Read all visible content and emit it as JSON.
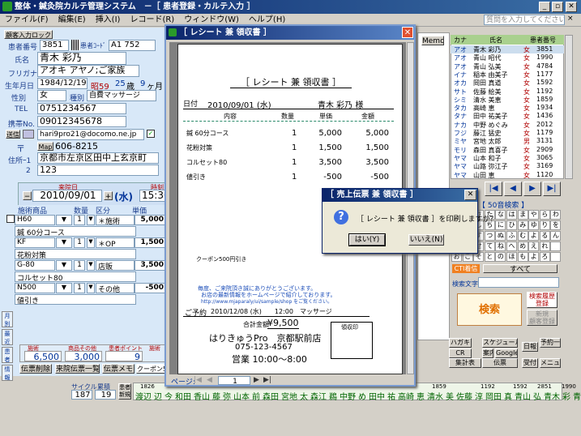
{
  "app": {
    "title": "整体・鍼灸院カルテ管理システム　－［ 患者登録・カルテ入力 ］",
    "search_placeholder": "質問を入力してください"
  },
  "menu": [
    "ファイル(F)",
    "編集(E)",
    "挿入(I)",
    "レコード(R)",
    "ウィンドウ(W)",
    "ヘルプ(H)"
  ],
  "patient": {
    "header_btn": "顧客入力ロック",
    "id_label": "患者番号",
    "id": "3851",
    "code_label": "患者ｺｰﾄﾞ",
    "code": "A1 752",
    "name_label": "氏名",
    "name": "青木 彩乃",
    "furigana_label": "フリガナ",
    "furigana": "アオキ アヤノ;ご家族",
    "dob_label": "生年月日",
    "dob": "1984/12/19",
    "era": "昭59",
    "age": "25",
    "age_unit": "歳",
    "months": "9",
    "months_unit": "ヶ月",
    "sex_label": "性別",
    "sex": "女",
    "category_label": "種別",
    "category": "自費マッサージ",
    "tel_label": "TEL",
    "tel": "0751234567",
    "mobile_label": "携帯No.",
    "mobile": "09012345678",
    "email_btn": "送信",
    "email": "hari9pro21@docomo.ne.jp",
    "map_btn": "Map",
    "zip": "606-8215",
    "addr_label": "住所ｰ1",
    "addr1": "京都市左京区田中上玄京町",
    "addr2_label": "2",
    "addr2": "123",
    "visit_label": "来院日",
    "visit_date": "2010/09/01",
    "weekday": "(水)",
    "time_label": "時刻",
    "time": "15:30"
  },
  "order": {
    "headers": [
      "施術商品",
      "数量",
      "区分",
      "単価"
    ],
    "rows": [
      {
        "code": "H60",
        "qty": "1",
        "kind": "＊施術",
        "price": "5,000",
        "desc": "鍼 60分コース"
      },
      {
        "code": "KF",
        "qty": "1",
        "kind": "＊OP",
        "price": "1,500",
        "desc": "花粉対策"
      },
      {
        "code": "G-80",
        "qty": "1",
        "kind": "店販",
        "price": "3,500",
        "desc": "コルセット80"
      },
      {
        "code": "N500",
        "qty": "1",
        "kind": "その他",
        "price": "-500",
        "desc": "値引き"
      }
    ],
    "totals_labels": [
      "施術",
      "商品その他",
      "患者ポイント",
      "施術"
    ],
    "totals": [
      "6,500",
      "3,000",
      "9"
    ],
    "btn_delete": "伝票削除",
    "btn_list": "来院伝票一覧",
    "btn_memo": "伝票メモ",
    "btn_coupon": "クーポン500",
    "side_tabs": [
      "月別",
      "最近",
      "患者",
      "情報"
    ],
    "cycle_label": "サイクル",
    "cycle_vals": [
      "187",
      "19"
    ],
    "cycle_sub": "累積",
    "renew": "患者新規"
  },
  "receipt_window": {
    "title": "［ レシート 兼 領収書 ］",
    "heading": "［ レシート 兼 領収書 ］",
    "date_label": "日付",
    "date": "2010/09/01 (水)",
    "customer": "青木 彩乃 様",
    "cols": [
      "内容",
      "数量",
      "単価",
      "金額"
    ],
    "lines": [
      {
        "item": "鍼 60分コース",
        "qty": "1",
        "unit": "5,000",
        "amount": "5,000"
      },
      {
        "item": "花粉対策",
        "qty": "1",
        "unit": "1,500",
        "amount": "1,500"
      },
      {
        "item": "コルセット80",
        "qty": "1",
        "unit": "3,500",
        "amount": "3,500"
      },
      {
        "item": "値引き",
        "qty": "1",
        "unit": "-500",
        "amount": "-500"
      }
    ],
    "coupon": "クーポン500円引き",
    "notice1": "毎度、ご来院頂き誠にありがとうございます。",
    "notice2": "お店の最新情報をホームページで紹介しております。",
    "notice3": "http://www.mjaparaly/ui/sample/shop をご覧ください。",
    "reserve_label": "ご予約",
    "reserve": "2010/12/08 (水)　　12:00　マッサージ",
    "total_label": "合計金額",
    "total": "¥9,500",
    "stamp_label": "領収印",
    "shop": "はりきゅうPro　京都駅前店",
    "shop_tel": "075-123-4567",
    "hours": "営業 10:00～8:00",
    "page_label": "ページ:",
    "page": "1"
  },
  "dialog": {
    "title": "［ 売上伝票 兼 領収書 ］",
    "message": "［ レシート 兼 領収書 ］を印刷しますか？",
    "yes": "はい(Y)",
    "no": "いいえ(N)"
  },
  "right_panel": {
    "memo_label": "Memo",
    "headers": [
      "カナ",
      "氏名",
      "患者番号"
    ],
    "rows": [
      [
        "アオ",
        "青木 彩乃",
        "女",
        "3851"
      ],
      [
        "アオ",
        "青山 昭代",
        "女",
        "1990"
      ],
      [
        "アオ",
        "青山 弘美",
        "女",
        "4784"
      ],
      [
        "イナ",
        "稲本 由美子",
        "女",
        "1177"
      ],
      [
        "オカ",
        "岡田 真道",
        "女",
        "1592"
      ],
      [
        "サト",
        "佐藤 絵美",
        "女",
        "1192"
      ],
      [
        "シミ",
        "清水 美恵",
        "女",
        "1859"
      ],
      [
        "タカ",
        "高崎 恵",
        "女",
        "1934"
      ],
      [
        "タナ",
        "田中 祐美子",
        "女",
        "1436"
      ],
      [
        "ナカ",
        "中野 めぐみ",
        "女",
        "2012"
      ],
      [
        "フジ",
        "藤江 猛史",
        "女",
        "1179"
      ],
      [
        "ミヤ",
        "宮地 太郎",
        "男",
        "3131"
      ],
      [
        "モリ",
        "森田 真喜子",
        "女",
        "2909"
      ],
      [
        "ヤマ",
        "山本 和子",
        "女",
        "3065"
      ],
      [
        "ヤマ",
        "山路 弥江子",
        "女",
        "3169"
      ],
      [
        "ヤマ",
        "山田 恵",
        "女",
        "1120"
      ]
    ],
    "nav": [
      "|◀",
      "◀",
      "▶",
      "▶|"
    ],
    "kana_title": "【 50音検索 】",
    "kana": [
      "あ",
      "か",
      "さ",
      "た",
      "な",
      "は",
      "ま",
      "や",
      "ら",
      "わ",
      "い",
      "き",
      "し",
      "ち",
      "に",
      "ひ",
      "み",
      "ゆ",
      "り",
      "を",
      "う",
      "く",
      "す",
      "つ",
      "ぬ",
      "ふ",
      "む",
      "よ",
      "る",
      "ん",
      "え",
      "け",
      "せ",
      "て",
      "ね",
      "へ",
      "め",
      "え",
      "れ",
      "",
      "お",
      "こ",
      "そ",
      "と",
      "の",
      "ほ",
      "も",
      "よ",
      "ろ",
      ""
    ],
    "cti": "CTI着信",
    "all": "すべて",
    "search_label": "検索文字",
    "search_btn": "検索",
    "btn_regist": "検索履歴\n登録",
    "btn_new": "新規\n顧客登録",
    "bottom": [
      "ハガキ",
      "スケジュール",
      "日報",
      "予約一覧",
      "CR",
      "案内",
      "Google",
      "集計表",
      "伝票",
      "受付",
      "メニュー"
    ]
  },
  "bottom_bar": {
    "name_strip": [
      "渡辺",
      "辺",
      "今",
      "和田",
      "香山",
      "藤",
      "弥",
      "山本",
      "前",
      "森田",
      "宮地",
      "太",
      "森江",
      "鵜",
      "中野",
      "め",
      "田中",
      "祐",
      "高崎",
      "恵",
      "清水",
      "美",
      "佐藤",
      "淳",
      "岡田",
      "真",
      "青山",
      "弘",
      "青木",
      "彩",
      "青山",
      "昭"
    ],
    "nums": [
      "1826",
      "1859",
      "1192",
      "1592",
      "2851",
      "1990"
    ]
  }
}
